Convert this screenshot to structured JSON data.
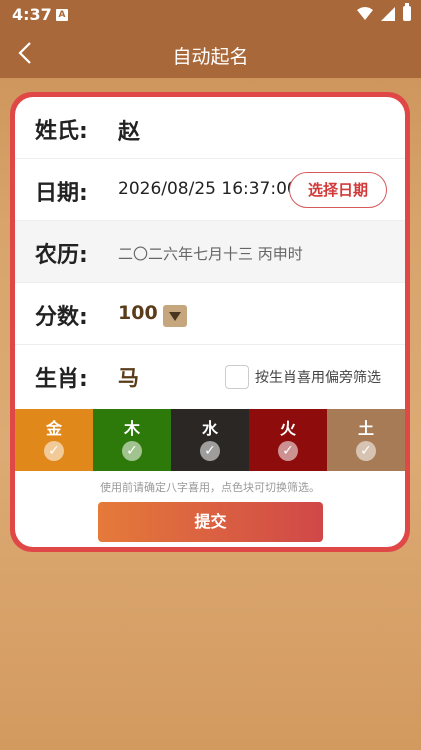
{
  "status_bar": {
    "time": "4:37",
    "notification_glyph": "A"
  },
  "nav": {
    "title": "自动起名"
  },
  "form": {
    "surname": {
      "label": "姓氏:",
      "value": "赵"
    },
    "date": {
      "label": "日期:",
      "value": "2026/08/25 16:37:00",
      "button": "选择日期"
    },
    "lunar": {
      "label": "农历:",
      "value": "二〇二六年七月十三 丙申时"
    },
    "score": {
      "label": "分数:",
      "value": "100"
    },
    "zodiac": {
      "label": "生肖:",
      "value": "马",
      "checkbox_label": "按生肖喜用偏旁筛选",
      "checked": false
    }
  },
  "elements": [
    {
      "name": "金",
      "check": "✓",
      "color": "#e0891a"
    },
    {
      "name": "木",
      "check": "✓",
      "color": "#2d7a0b"
    },
    {
      "name": "水",
      "check": "✓",
      "color": "#2a2725"
    },
    {
      "name": "火",
      "check": "✓",
      "color": "#8f0c0c"
    },
    {
      "name": "土",
      "check": "✓",
      "color": "#a67b55"
    }
  ],
  "hint": "使用前请确定八字喜用，点色块可切换筛选。",
  "submit_label": "提交",
  "colors": {
    "accent": "#e04848",
    "header": "#a9683a"
  }
}
